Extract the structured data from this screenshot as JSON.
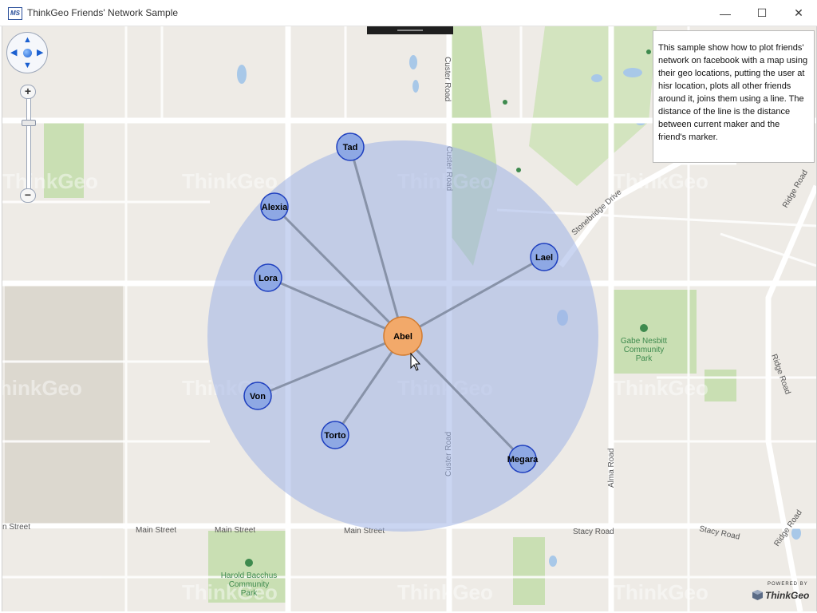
{
  "window": {
    "title": "ThinkGeo Friends' Network Sample",
    "app_icon_text": "MS",
    "controls": {
      "minimize": "—",
      "maximize": "☐",
      "close": "✕"
    }
  },
  "info_panel": {
    "text": "This sample show how to plot friends' network on facebook with a map using their geo locations, putting the user at hisr location, plots all other friends around it, joins them using a line. The distance of the line is the distance between current maker and the friend's marker."
  },
  "map": {
    "center_user": "Abel",
    "friends": [
      "Tad",
      "Alexia",
      "Lora",
      "Von",
      "Torto",
      "Megara",
      "Lael"
    ],
    "roads": {
      "custer_road": "Custer Road",
      "main_street": "Main Street",
      "main_street_west": "n Street",
      "stacy_road": "Stacy Road",
      "alma_road": "Alma Road",
      "ridge_road": "Ridge Road",
      "stonebridge_drive": "Stonebridge Drive"
    },
    "parks": {
      "gabe_nesbitt": [
        "Gabe Nesbitt",
        "Community",
        "Park"
      ],
      "harold_bacchus": [
        "Harold Bacchus",
        "Community",
        "Park"
      ]
    },
    "watermark": "ThinkGeo"
  },
  "navigation": {
    "pan_arrows": {
      "up": "▲",
      "down": "▼",
      "left": "◀",
      "right": "▶"
    },
    "zoom_in": "+",
    "zoom_out": "−"
  },
  "powered_by": {
    "caption": "POWERED BY",
    "brand": "ThinkGeo"
  },
  "colors": {
    "buffer_fill": "#9fb3e6",
    "friend_marker": "#8ea8e4",
    "friend_stroke": "#1e3fbf",
    "center_marker": "#f2a96a",
    "center_stroke": "#d17b30",
    "connection_line": "#7d879c",
    "park_green": "#c9dfb3"
  }
}
